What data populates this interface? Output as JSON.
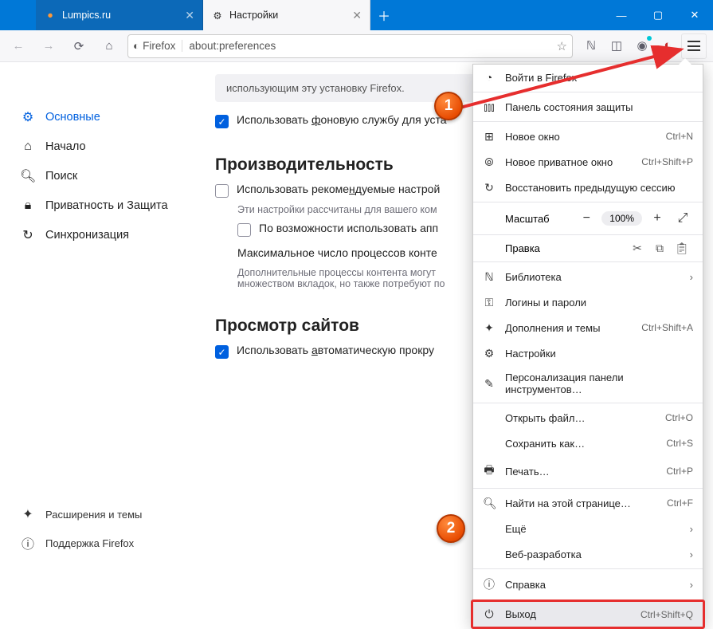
{
  "tabs": [
    {
      "label": "Lumpics.ru"
    },
    {
      "label": "Настройки"
    }
  ],
  "url": {
    "identity": "Firefox",
    "value": "about:preferences"
  },
  "sidebar": {
    "items": [
      {
        "label": "Основные"
      },
      {
        "label": "Начало"
      },
      {
        "label": "Поиск"
      },
      {
        "label": "Приватность и Защита"
      },
      {
        "label": "Синхронизация"
      }
    ],
    "footer": [
      {
        "label": "Расширения и темы"
      },
      {
        "label": "Поддержка Firefox"
      }
    ]
  },
  "main": {
    "info_line2": "использующим эту установку Firefox.",
    "chk_bg": "Использовать фоновую службу для уста",
    "sec_perf": "Производительность",
    "perf_rec": "Использовать рекомендуемые настрой",
    "perf_hint": "Эти настройки рассчитаны для вашего ком",
    "perf_hw": "По возможности использовать апп",
    "perf_proc": "Максимальное число процессов конте",
    "perf_hint2": "Дополнительные процессы контента могут\nмножеством вкладок, но также потребуют по",
    "sec_browse": "Просмотр сайтов",
    "browse_auto": "Использовать автоматическую прокру"
  },
  "menu": {
    "signin": "Войти в Firefox",
    "protection": "Панель состояния защиты",
    "newwin": "Новое окно",
    "newwin_s": "Ctrl+N",
    "newpriv": "Новое приватное окно",
    "newpriv_s": "Ctrl+Shift+P",
    "restore": "Восстановить предыдущую сессию",
    "zoom": "Масштаб",
    "zoom_v": "100%",
    "edit": "Правка",
    "library": "Библиотека",
    "logins": "Логины и пароли",
    "addons": "Дополнения и темы",
    "addons_s": "Ctrl+Shift+A",
    "settings": "Настройки",
    "customize": "Персонализация панели инструментов…",
    "open": "Открыть файл…",
    "open_s": "Ctrl+O",
    "save": "Сохранить как…",
    "save_s": "Ctrl+S",
    "print": "Печать…",
    "print_s": "Ctrl+P",
    "find": "Найти на этой странице…",
    "find_s": "Ctrl+F",
    "more": "Ещё",
    "webdev": "Веб-разработка",
    "help": "Справка",
    "exit": "Выход",
    "exit_s": "Ctrl+Shift+Q"
  },
  "callouts": {
    "c1": "1",
    "c2": "2"
  }
}
